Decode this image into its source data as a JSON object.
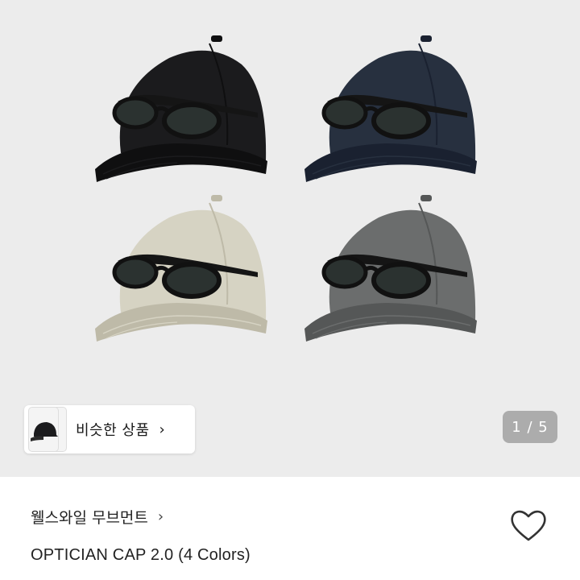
{
  "product_images": [
    {
      "name": "cap-black",
      "color": "#1b1b1d",
      "shade": "#0f0f10"
    },
    {
      "name": "cap-navy",
      "color": "#27303f",
      "shade": "#1a2130"
    },
    {
      "name": "cap-beige",
      "color": "#d6d3c3",
      "shade": "#bebaa8"
    },
    {
      "name": "cap-gray",
      "color": "#6b6d6d",
      "shade": "#555757"
    }
  ],
  "similar": {
    "label": "비슷한 상품",
    "chevron": "›"
  },
  "pager": {
    "text": "1 / 5"
  },
  "brand": {
    "name": "웰스와일 무브먼트",
    "chevron": "›"
  },
  "product": {
    "title": "OPTICIAN CAP 2.0 (4 Colors)"
  },
  "icons": {
    "wishlist": "heart-outline-icon",
    "similar_thumb": "cap-thumbnail"
  },
  "colors": {
    "hero_bg": "#ececec",
    "lens": "#2b3230"
  }
}
